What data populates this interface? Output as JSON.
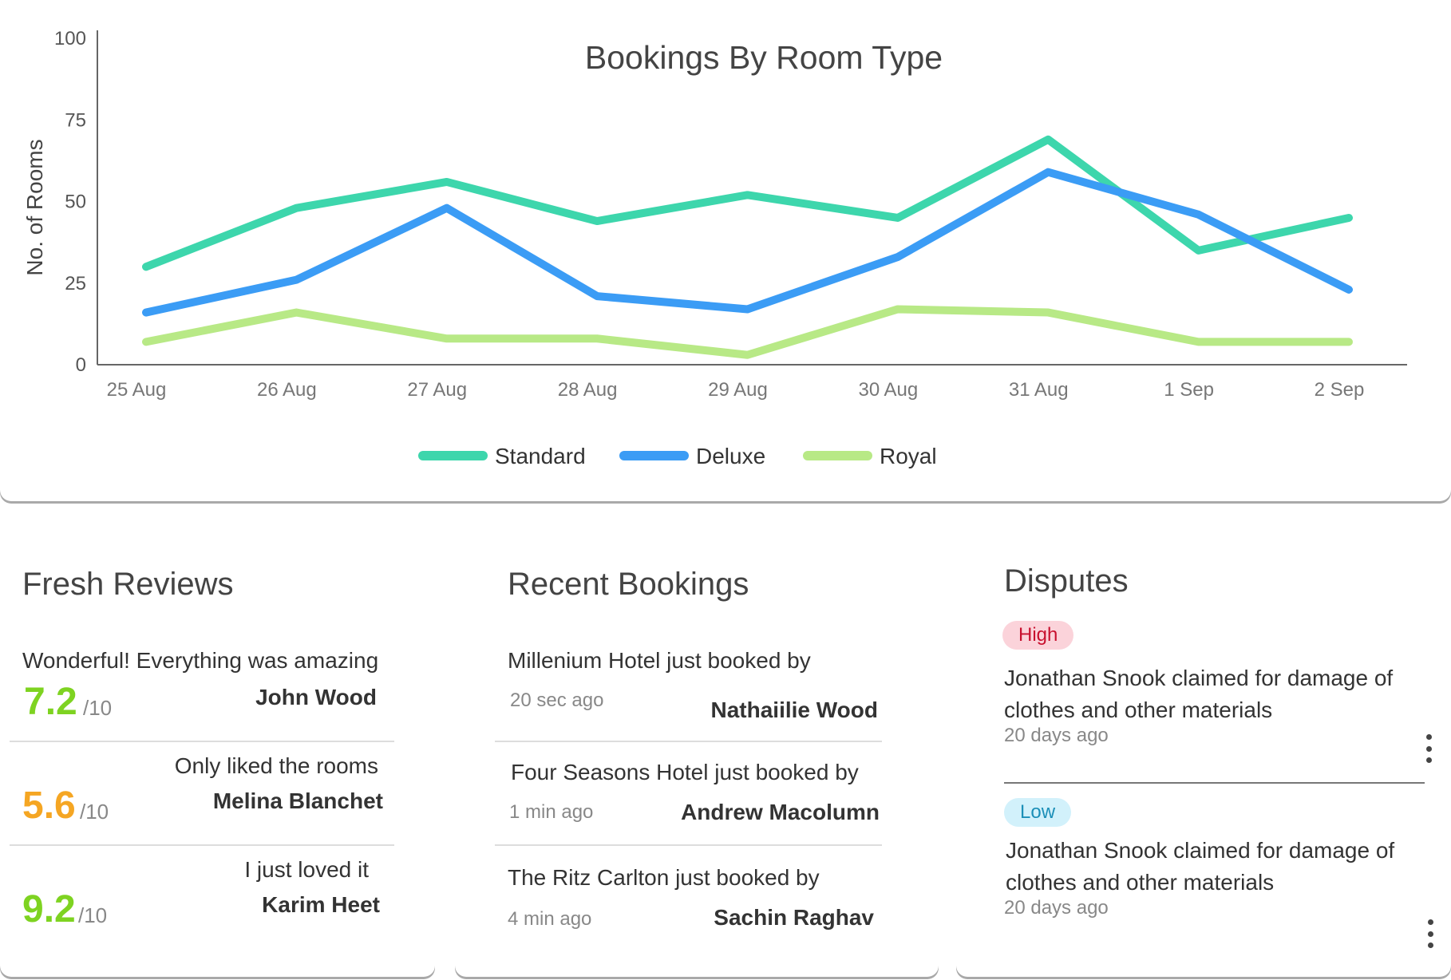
{
  "chart_data": {
    "type": "line",
    "title": "Bookings By Room Type",
    "xlabel": "",
    "ylabel": "No. of Rooms",
    "categories": [
      "25 Aug",
      "26 Aug",
      "27 Aug",
      "28 Aug",
      "29 Aug",
      "30 Aug",
      "31 Aug",
      "1 Sep",
      "2 Sep"
    ],
    "y_ticks": [
      0,
      25,
      50,
      75,
      100
    ],
    "ylim": [
      0,
      100
    ],
    "grid": false,
    "legend_position": "bottom",
    "series": [
      {
        "name": "Standard",
        "color": "#3dd6ac",
        "values": [
          30,
          48,
          56,
          44,
          52,
          45,
          69,
          35,
          45
        ]
      },
      {
        "name": "Deluxe",
        "color": "#3b9cf5",
        "values": [
          16,
          26,
          48,
          21,
          17,
          33,
          59,
          46,
          23
        ]
      },
      {
        "name": "Royal",
        "color": "#b8e986",
        "values": [
          7,
          16,
          8,
          8,
          3,
          17,
          16,
          7,
          7
        ]
      }
    ]
  },
  "reviews": {
    "title": "Fresh Reviews",
    "out_of": "/10",
    "items": [
      {
        "text": "Wonderful! Everything was amazing",
        "score": "7.2",
        "score_color": "#7ed321",
        "name": "John Wood"
      },
      {
        "text": "Only liked the rooms",
        "score": "5.6",
        "score_color": "#f5a623",
        "name": "Melina Blanchet"
      },
      {
        "text": "I just loved it",
        "score": "9.2",
        "score_color": "#7ed321",
        "name": "Karim Heet"
      }
    ]
  },
  "bookings": {
    "title": "Recent Bookings",
    "items": [
      {
        "text": "Millenium Hotel just booked by",
        "time": "20 sec ago",
        "name": "Nathaiilie Wood"
      },
      {
        "text": "Four Seasons Hotel just booked by",
        "time": "1 min ago",
        "name": "Andrew Macolumn"
      },
      {
        "text": "The Ritz Carlton just booked by",
        "time": "4 min ago",
        "name": "Sachin Raghav"
      }
    ]
  },
  "disputes": {
    "title": "Disputes",
    "items": [
      {
        "priority": "High",
        "priority_color": "#c8102e",
        "text": "Jonathan Snook claimed for damage of clothes and other materials",
        "time": "20 days ago",
        "menu_icon": "more-vertical-icon"
      },
      {
        "priority": "Low",
        "priority_color": "#1c8fb8",
        "text": "Jonathan Snook claimed for damage of clothes and other materials",
        "time": "20 days ago",
        "menu_icon": "more-vertical-icon"
      }
    ]
  }
}
